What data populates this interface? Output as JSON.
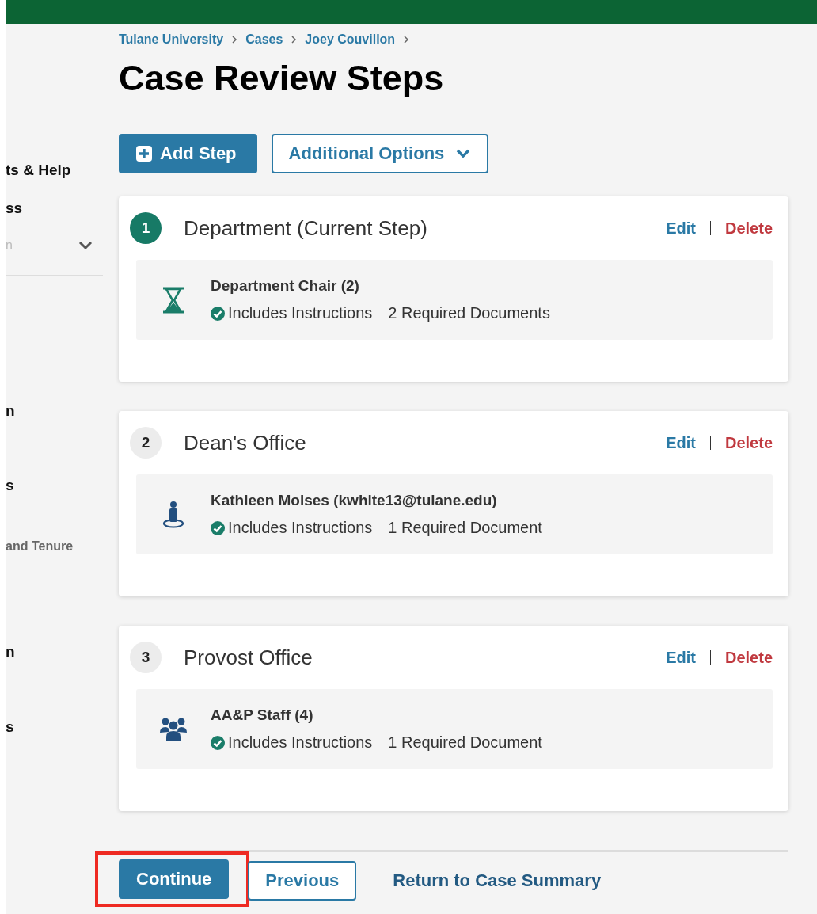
{
  "sidebar": {
    "items": [
      {
        "text": "ts & Help",
        "kind": "heading",
        "divider_after": false
      },
      {
        "text": "ss",
        "kind": "heading",
        "divider_after": false
      },
      {
        "text": "n",
        "kind": "dropdown",
        "divider_after": true
      },
      {
        "text": "n",
        "kind": "heading",
        "divider_after": false
      },
      {
        "text": "s",
        "kind": "heading",
        "divider_after": true
      },
      {
        "text": "and Tenure",
        "kind": "sub",
        "divider_after": false
      },
      {
        "text": "n",
        "kind": "heading",
        "divider_after": false
      },
      {
        "text": "s",
        "kind": "heading",
        "divider_after": false
      }
    ]
  },
  "breadcrumb": [
    "Tulane University",
    "Cases",
    "Joey Couvillon"
  ],
  "title": "Case Review Steps",
  "toolbar": {
    "add_button": "Add Step",
    "options_button": "Additional Options"
  },
  "steps": [
    {
      "number": "1",
      "title": "Department (Current Step)",
      "current": true,
      "edit": "Edit",
      "delete": "Delete",
      "assignee": "Department Chair (2)",
      "kind": "hourglass",
      "instructions": "Includes Instructions",
      "documents": "2 Required Documents"
    },
    {
      "number": "2",
      "title": "Dean's Office",
      "current": false,
      "edit": "Edit",
      "delete": "Delete",
      "assignee": "Kathleen Moises (kwhite13@tulane.edu)",
      "kind": "person",
      "instructions": "Includes Instructions",
      "documents": "1 Required Document"
    },
    {
      "number": "3",
      "title": "Provost Office",
      "current": false,
      "edit": "Edit",
      "delete": "Delete",
      "assignee": "AA&P Staff (4)",
      "kind": "group",
      "instructions": "Includes Instructions",
      "documents": "1 Required Document"
    }
  ],
  "footer": {
    "continue": {
      "label": "Continue",
      "highlighted": true
    },
    "previous": "Previous",
    "return_link": "Return to Case Summary"
  }
}
